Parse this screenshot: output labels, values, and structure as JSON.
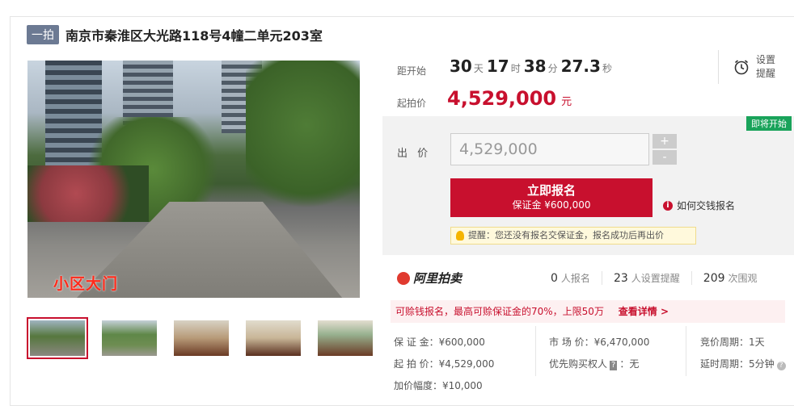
{
  "header": {
    "badge": "一拍",
    "title": "南京市秦淮区大光路118号4幢二单元203室"
  },
  "photo": {
    "caption": "小区大门"
  },
  "thumbnails": [
    {
      "alt": "小区大门"
    },
    {
      "alt": "小区外景"
    },
    {
      "alt": "室内客厅"
    },
    {
      "alt": "室内房间"
    },
    {
      "alt": "室内餐厅"
    }
  ],
  "countdown": {
    "label": "距开始",
    "days": "30",
    "days_unit": "天",
    "hours": "17",
    "hours_unit": "时",
    "minutes": "38",
    "minutes_unit": "分",
    "seconds": "27.3",
    "seconds_unit": "秒"
  },
  "start_price": {
    "label": "起拍价",
    "value": "4,529,000",
    "unit": "元"
  },
  "reminder": {
    "label": "设置提醒"
  },
  "status_badge": "即将开始",
  "bid": {
    "label": "出 价",
    "value": "4,529,000",
    "plus": "+",
    "minus": "-"
  },
  "signup_button": {
    "line1": "立即报名",
    "line2": "保证金 ¥600,000"
  },
  "how_to": "如何交钱报名",
  "tip": "提醒：您还没有报名交保证金，报名成功后再出价",
  "brand": "阿里拍卖",
  "stats": [
    {
      "num": "0",
      "label": "人报名"
    },
    {
      "num": "23",
      "label": "人设置提醒"
    },
    {
      "num": "209",
      "label": "次围观"
    }
  ],
  "notice": {
    "text": "可赊钱报名，最高可赊保证金的70%，上限50万",
    "link": "查看详情 >"
  },
  "info": {
    "deposit": "保 证 金：¥600,000",
    "start_price": "起 拍 价：¥4,529,000",
    "increment": "加价幅度：¥10,000",
    "market_price": "市 场 价：¥6,470,000",
    "priority_pre": "优先购买权人",
    "priority_tag": "?",
    "priority_post": "：无",
    "cycle": "竞价周期：1天",
    "delay": "延时周期：5分钟"
  }
}
